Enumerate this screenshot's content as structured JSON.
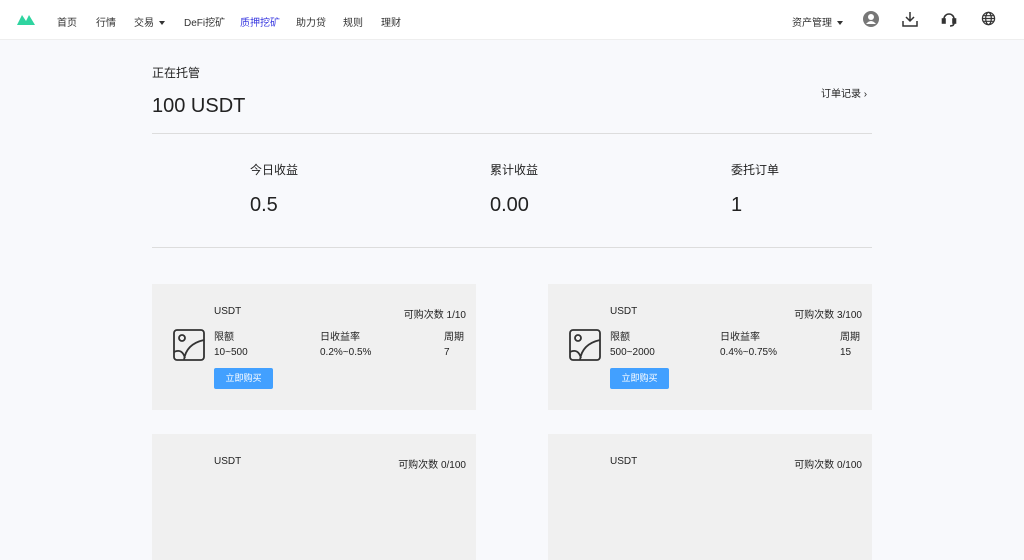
{
  "nav": {
    "items": [
      "首页",
      "行情",
      "交易",
      "DeFi挖矿",
      "质押挖矿",
      "助力贷",
      "规则",
      "理财"
    ],
    "asset_menu": "资产管理",
    "accent": "#3a3ae0"
  },
  "summary": {
    "title": "正在托管",
    "amount": "100 USDT",
    "order_link": "订单记录",
    "stats": [
      {
        "label": "今日收益",
        "value": "0.5"
      },
      {
        "label": "累计收益",
        "value": "0.00"
      },
      {
        "label": "委托订单",
        "value": "1"
      }
    ]
  },
  "products": [
    {
      "coin": "USDT",
      "remaining": "可购次数 1/10",
      "limit_label": "限额",
      "limit": "10~500",
      "rate_label": "日收益率",
      "rate": "0.2%~0.5%",
      "period_label": "周期",
      "period": "7",
      "buy": "立即购买"
    },
    {
      "coin": "USDT",
      "remaining": "可购次数 3/100",
      "limit_label": "限额",
      "limit": "500~2000",
      "rate_label": "日收益率",
      "rate": "0.4%~0.75%",
      "period_label": "周期",
      "period": "15",
      "buy": "立即购买"
    },
    {
      "coin": "USDT",
      "remaining": "可购次数 0/100"
    },
    {
      "coin": "USDT",
      "remaining": "可购次数 0/100"
    }
  ]
}
